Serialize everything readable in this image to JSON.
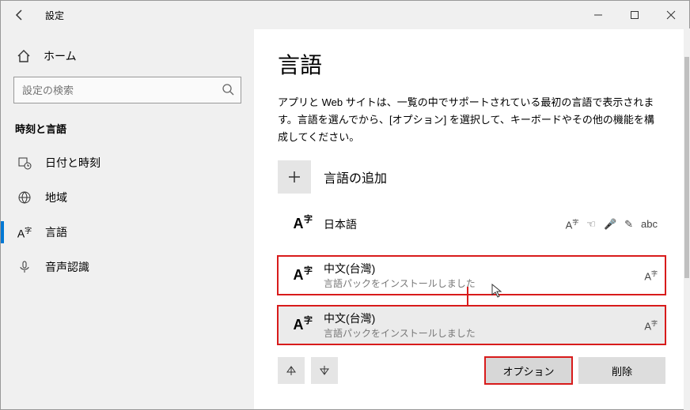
{
  "window": {
    "title": "設定"
  },
  "sidebar": {
    "home": "ホーム",
    "search_placeholder": "設定の検索",
    "category": "時刻と言語",
    "items": [
      {
        "label": "日付と時刻"
      },
      {
        "label": "地域"
      },
      {
        "label": "言語"
      },
      {
        "label": "音声認識"
      }
    ]
  },
  "page": {
    "title": "言語",
    "desc": "アプリと Web サイトは、一覧の中でサポートされている最初の言語で表示されます。言語を選んでから、[オプション] を選択して、キーボードやその他の機能を構成してください。",
    "add_label": "言語の追加",
    "languages": [
      {
        "name": "日本語",
        "sub": ""
      },
      {
        "name": "中文(台灣)",
        "sub": "言語パックをインストールしました"
      },
      {
        "name": "中文(台灣)",
        "sub": "言語パックをインストールしました"
      }
    ],
    "options_label": "オプション",
    "delete_label": "削除"
  }
}
